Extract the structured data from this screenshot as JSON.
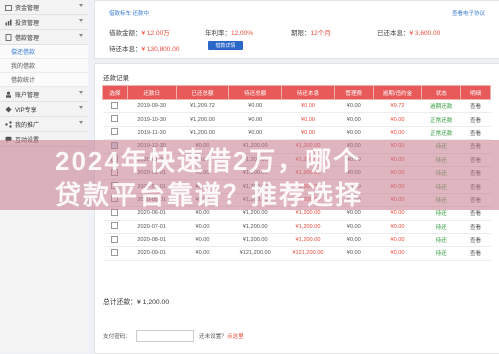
{
  "sidebar": {
    "items": [
      {
        "label": "资金管理"
      },
      {
        "label": "投资管理"
      },
      {
        "label": "借款管理"
      }
    ],
    "sub_items": [
      {
        "label": "偿还借款"
      },
      {
        "label": "我的借款"
      },
      {
        "label": "借款统计"
      }
    ],
    "items2": [
      {
        "label": "账户管理"
      },
      {
        "label": "VIP专享"
      },
      {
        "label": "我的推广"
      },
      {
        "label": "互动设置"
      }
    ]
  },
  "loan": {
    "header": "借款标车 还款中",
    "header_right": "查看电子协议",
    "amount_label": "借款金额：",
    "amount": "¥ 12.00万",
    "rate_label": "年利率：",
    "rate": "12.00%",
    "period_label": "期限：",
    "period": "12个月",
    "repaid_label": "已还本息：",
    "repaid": "¥ 3,600.00",
    "remain_label": "待还本息：",
    "remain": "¥ 130,800.00",
    "button": "借款详情"
  },
  "records": {
    "title": "还款记录",
    "headers": [
      "选择",
      "还款日",
      "已还总额",
      "待还总额",
      "待还本息",
      "管理费",
      "逾期/违约金",
      "状态",
      "明细"
    ],
    "rows": [
      {
        "cb": "",
        "date": "2019-09-30",
        "paid": "¥1,209.72",
        "due": "¥0.00",
        "principal": "¥0.00",
        "fee": "¥0.00",
        "late": "¥9.72",
        "status": "逾期还款",
        "detail": "查看"
      },
      {
        "cb": "",
        "date": "2019-10-30",
        "paid": "¥1,200.00",
        "due": "¥0.00",
        "principal": "¥0.00",
        "fee": "¥0.00",
        "late": "¥0.00",
        "status": "正常还款",
        "detail": "查看"
      },
      {
        "cb": "",
        "date": "2019-11-30",
        "paid": "¥1,200.00",
        "due": "¥0.00",
        "principal": "¥0.00",
        "fee": "¥0.00",
        "late": "¥0.00",
        "status": "正常还款",
        "detail": "查看"
      },
      {
        "cb": "on",
        "date": "2019-12-30",
        "paid": "¥0.00",
        "due": "¥1,200.00",
        "principal": "¥1,200.00",
        "fee": "¥0.00",
        "late": "¥0.00",
        "status": "待还",
        "detail": "查看"
      },
      {
        "cb": "",
        "date": "2020-01-30",
        "paid": "¥0.00",
        "due": "¥1,200.00",
        "principal": "¥1,200.00",
        "fee": "¥0.00",
        "late": "¥0.00",
        "status": "待还",
        "detail": "查看"
      },
      {
        "cb": "",
        "date": "2020-03-01",
        "paid": "¥0.00",
        "due": "¥1,200.00",
        "principal": "¥1,200.00",
        "fee": "¥0.00",
        "late": "¥0.00",
        "status": "待还",
        "detail": "查看"
      },
      {
        "cb": "",
        "date": "2020-04-01",
        "paid": "¥0.00",
        "due": "¥1,200.00",
        "principal": "¥1,200.00",
        "fee": "¥0.00",
        "late": "¥0.00",
        "status": "待还",
        "detail": "查看"
      },
      {
        "cb": "",
        "date": "2020-05-01",
        "paid": "¥0.00",
        "due": "¥1,200.00",
        "principal": "¥1,200.00",
        "fee": "¥0.00",
        "late": "¥0.00",
        "status": "待还",
        "detail": "查看"
      },
      {
        "cb": "",
        "date": "2020-06-01",
        "paid": "¥0.00",
        "due": "¥1,200.00",
        "principal": "¥1,200.00",
        "fee": "¥0.00",
        "late": "¥0.00",
        "status": "待还",
        "detail": "查看"
      },
      {
        "cb": "",
        "date": "2020-07-01",
        "paid": "¥0.00",
        "due": "¥1,200.00",
        "principal": "¥1,200.00",
        "fee": "¥0.00",
        "late": "¥0.00",
        "status": "待还",
        "detail": "查看"
      },
      {
        "cb": "",
        "date": "2020-08-01",
        "paid": "¥0.00",
        "due": "¥1,200.00",
        "principal": "¥1,200.00",
        "fee": "¥0.00",
        "late": "¥0.00",
        "status": "待还",
        "detail": "查看"
      },
      {
        "cb": "",
        "date": "2020-09-01",
        "paid": "¥0.00",
        "due": "¥121,200.00",
        "principal": "¥121,200.00",
        "fee": "¥0.00",
        "late": "¥0.00",
        "status": "待还",
        "detail": "查看"
      }
    ],
    "total_label": "总计还款：",
    "total_value": "¥ 1,200.00",
    "pay_label": "支付密码：",
    "pay_hint": "还未设置？",
    "pay_link": "点这里"
  },
  "watermark": {
    "line1": "2024年快速借2万，哪个",
    "line2": "贷款平台靠谱？推荐选择"
  },
  "colors": {
    "accent": "#e85a5a",
    "link": "#3a7bd5",
    "primary_btn": "#2a67c8"
  }
}
